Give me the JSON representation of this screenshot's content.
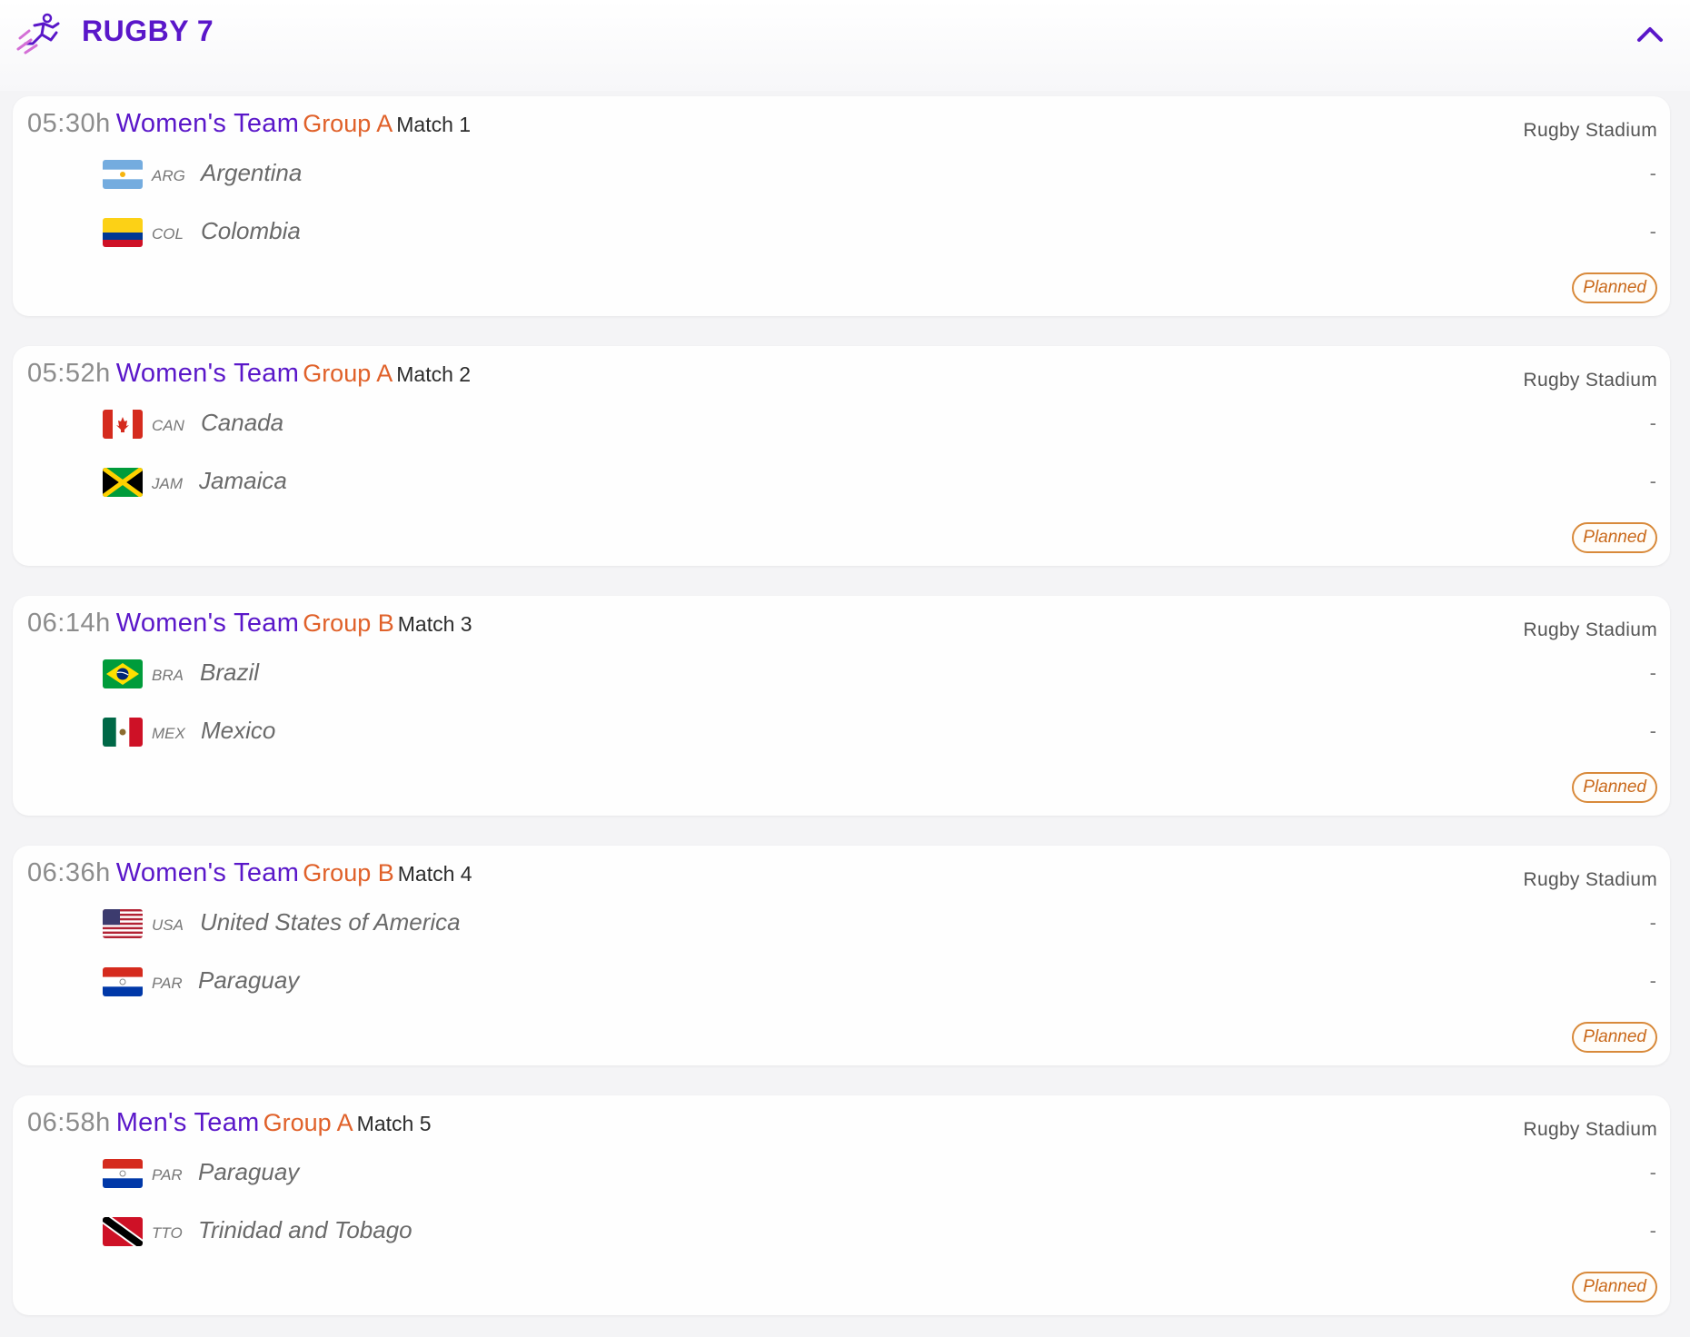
{
  "header": {
    "title": "RUGBY 7",
    "icon": "running-athlete-icon",
    "collapse_icon": "chevron-up-icon",
    "accent_color": "#5a17c9"
  },
  "matches": [
    {
      "time": "05:30h",
      "category": "Women's Team",
      "group": "Group A",
      "match": "Match 1",
      "venue": "Rugby Stadium",
      "status": "Planned",
      "teams": [
        {
          "code": "ARG",
          "name": "Argentina",
          "score": "-",
          "flag": "flag-argentina-icon"
        },
        {
          "code": "COL",
          "name": "Colombia",
          "score": "-",
          "flag": "flag-colombia-icon"
        }
      ]
    },
    {
      "time": "05:52h",
      "category": "Women's Team",
      "group": "Group A",
      "match": "Match 2",
      "venue": "Rugby Stadium",
      "status": "Planned",
      "teams": [
        {
          "code": "CAN",
          "name": "Canada",
          "score": "-",
          "flag": "flag-canada-icon"
        },
        {
          "code": "JAM",
          "name": "Jamaica",
          "score": "-",
          "flag": "flag-jamaica-icon"
        }
      ]
    },
    {
      "time": "06:14h",
      "category": "Women's Team",
      "group": "Group B",
      "match": "Match 3",
      "venue": "Rugby Stadium",
      "status": "Planned",
      "teams": [
        {
          "code": "BRA",
          "name": "Brazil",
          "score": "-",
          "flag": "flag-brazil-icon"
        },
        {
          "code": "MEX",
          "name": "Mexico",
          "score": "-",
          "flag": "flag-mexico-icon"
        }
      ]
    },
    {
      "time": "06:36h",
      "category": "Women's Team",
      "group": "Group B",
      "match": "Match 4",
      "venue": "Rugby Stadium",
      "status": "Planned",
      "teams": [
        {
          "code": "USA",
          "name": "United States of America",
          "score": "-",
          "flag": "flag-usa-icon"
        },
        {
          "code": "PAR",
          "name": "Paraguay",
          "score": "-",
          "flag": "flag-paraguay-icon"
        }
      ]
    },
    {
      "time": "06:58h",
      "category": "Men's Team",
      "group": "Group A",
      "match": "Match 5",
      "venue": "Rugby Stadium",
      "status": "Planned",
      "teams": [
        {
          "code": "PAR",
          "name": "Paraguay",
          "score": "-",
          "flag": "flag-paraguay-icon"
        },
        {
          "code": "TTO",
          "name": "Trinidad and Tobago",
          "score": "-",
          "flag": "flag-trinidad-and-tobago-icon"
        }
      ]
    }
  ]
}
